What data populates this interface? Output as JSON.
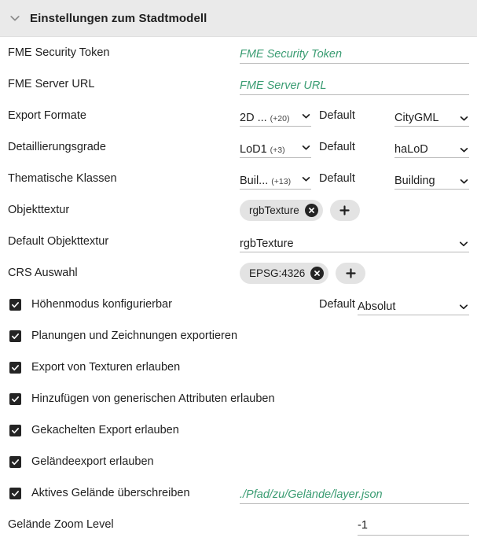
{
  "header": {
    "title": "Einstellungen zum Stadtmodell",
    "collapse_icon": "chevron-down-icon"
  },
  "rows": {
    "fme_security_token": {
      "label": "FME Security Token",
      "placeholder": "FME Security Token",
      "value": ""
    },
    "fme_server_url": {
      "label": "FME Server URL",
      "placeholder": "FME Server URL",
      "value": ""
    },
    "export_formate": {
      "label": "Export Formate",
      "select_value": "2D ...",
      "select_extra": "(+20)",
      "middle": "Default",
      "right_value": "CityGML"
    },
    "detaillierungsgrade": {
      "label": "Detaillierungsgrade",
      "select_value": "LoD1",
      "select_extra": "(+3)",
      "middle": "Default",
      "right_value": "haLoD"
    },
    "thematische_klassen": {
      "label": "Thematische Klassen",
      "select_value": "Buil...",
      "select_extra": "(+13)",
      "middle": "Default",
      "right_value": "Building"
    },
    "objekttextur": {
      "label": "Objekttextur",
      "chips": [
        "rgbTexture"
      ],
      "add_label": "+"
    },
    "default_objekttextur": {
      "label": "Default Objekttextur",
      "select_value": "rgbTexture"
    },
    "crs_auswahl": {
      "label": "CRS Auswahl",
      "chips": [
        "EPSG:4326"
      ],
      "add_label": "+"
    },
    "hoehenmodus": {
      "label": "Höhenmodus konfigurierbar",
      "checked": true,
      "middle": "Default",
      "right_value": "Absolut"
    },
    "planungen": {
      "label": "Planungen und Zeichnungen exportieren",
      "checked": true
    },
    "texturen": {
      "label": "Export von Texturen erlauben",
      "checked": true
    },
    "generische_attribute": {
      "label": "Hinzufügen von generischen Attributen erlauben",
      "checked": true
    },
    "gekachelter_export": {
      "label": "Gekachelten Export erlauben",
      "checked": true
    },
    "gelaendeexport": {
      "label": "Geländeexport erlauben",
      "checked": true
    },
    "aktives_gelaende": {
      "label": "Aktives Gelände überschreiben",
      "checked": true,
      "placeholder": "./Pfad/zu/Gelände/layer.json"
    },
    "gelaende_zoom_level": {
      "label": "Gelände Zoom Level",
      "value": "-1"
    }
  },
  "colors": {
    "header_bg": "#eaeaea",
    "placeholder_green": "#3a9c72",
    "chip_bg": "#e3e3e3",
    "checkbox_fill": "#242424",
    "underline": "#b9b9b9"
  }
}
